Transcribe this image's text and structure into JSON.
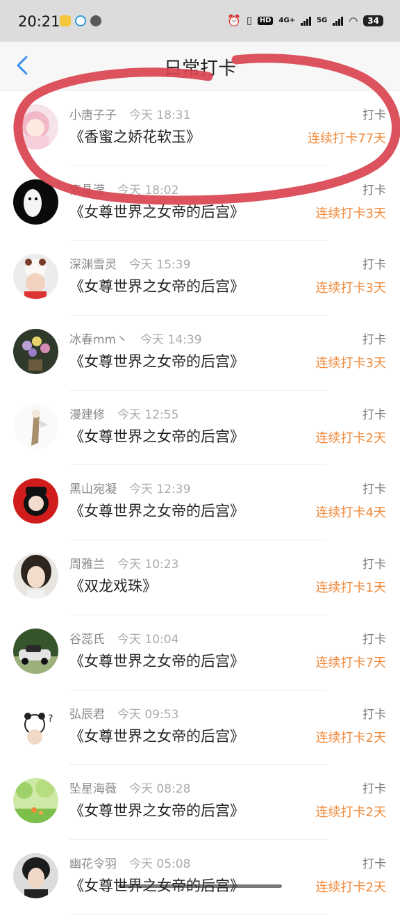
{
  "status_bar": {
    "time": "20:21",
    "network_labels": [
      "HD",
      "4G+",
      "5G"
    ],
    "battery": "34"
  },
  "nav": {
    "title": "日常打卡",
    "back_icon": "chevron-left-icon"
  },
  "list": {
    "action_label": "打卡",
    "rows": [
      {
        "name": "小唐子子",
        "time": "今天 18:31",
        "book": "《香蜜之娇花软玉》",
        "streak": "连续打卡77天"
      },
      {
        "name": "索晶滢",
        "time": "今天 18:02",
        "book": "《女尊世界之女帝的后宫》",
        "streak": "连续打卡3天"
      },
      {
        "name": "深渊雪灵",
        "time": "今天 15:39",
        "book": "《女尊世界之女帝的后宫》",
        "streak": "连续打卡3天"
      },
      {
        "name": "冰春mm丶",
        "time": "今天 14:39",
        "book": "《女尊世界之女帝的后宫》",
        "streak": "连续打卡3天"
      },
      {
        "name": "漫建修",
        "time": "今天 12:55",
        "book": "《女尊世界之女帝的后宫》",
        "streak": "连续打卡2天"
      },
      {
        "name": "黑山宛凝",
        "time": "今天 12:39",
        "book": "《女尊世界之女帝的后宫》",
        "streak": "连续打卡4天"
      },
      {
        "name": "周雅兰",
        "time": "今天 10:23",
        "book": "《双龙戏珠》",
        "streak": "连续打卡1天"
      },
      {
        "name": "谷蕊氏",
        "time": "今天 10:04",
        "book": "《女尊世界之女帝的后宫》",
        "streak": "连续打卡7天"
      },
      {
        "name": "弘辰君",
        "time": "今天 09:53",
        "book": "《女尊世界之女帝的后宫》",
        "streak": "连续打卡2天"
      },
      {
        "name": "坠星海薇",
        "time": "今天 08:28",
        "book": "《女尊世界之女帝的后宫》",
        "streak": "连续打卡2天"
      },
      {
        "name": "幽花令羽",
        "time": "今天 05:08",
        "book": "《女尊世界之女帝的后宫》",
        "streak": "连续打卡2天"
      }
    ]
  },
  "colors": {
    "accent_blue": "#3a8ef6",
    "streak_orange": "#ef8a3c",
    "annotation_red": "#d9434f"
  }
}
